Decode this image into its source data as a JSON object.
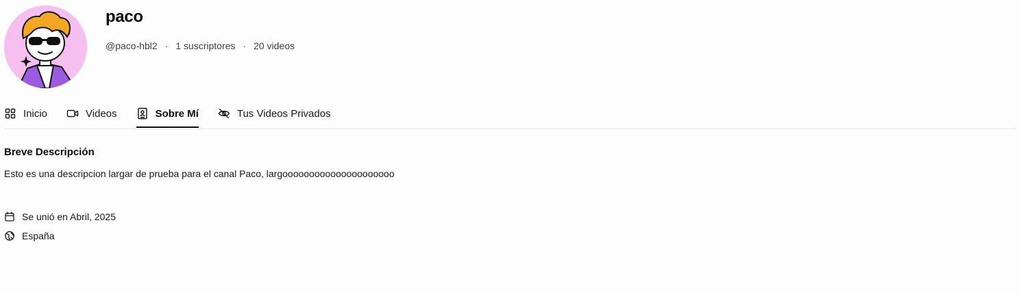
{
  "channel": {
    "name": "paco",
    "handle": "@paco-hbl2",
    "subscribers": "1 suscriptores",
    "videos": "20 videos",
    "separator": "·",
    "avatar_bg": "#f5c0f0"
  },
  "tabs": [
    {
      "label": "Inicio",
      "icon": "grid-icon",
      "active": false
    },
    {
      "label": "Videos",
      "icon": "video-camera-icon",
      "active": false
    },
    {
      "label": "Sobre Mí",
      "icon": "contact-book-icon",
      "active": true
    },
    {
      "label": "Tus Videos Privados",
      "icon": "eye-off-icon",
      "active": false
    }
  ],
  "about": {
    "title": "Breve Descripción",
    "description": "Esto es una descripcion largar de prueba para el canal Paco, largooooooooooooooooooooo",
    "joined": "Se unió en Abril, 2025",
    "country": "España"
  },
  "colors": {
    "active_tab_underline": "#0a0a0a",
    "divider": "#e4e4e7"
  }
}
